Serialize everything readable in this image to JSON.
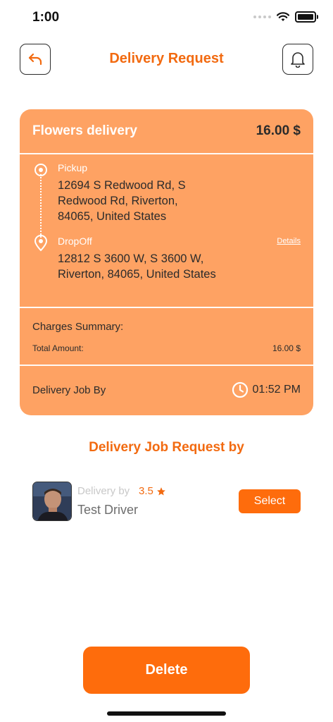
{
  "status_bar": {
    "time": "1:00"
  },
  "header": {
    "title": "Delivery Request",
    "back_icon": "back-arrow-icon",
    "bell_icon": "bell-icon"
  },
  "job": {
    "title": "Flowers delivery",
    "price": "16.00 $",
    "pickup": {
      "label": "Pickup",
      "address": "12694 S Redwood Rd, S Redwood Rd, Riverton, 84065, United States"
    },
    "dropoff": {
      "label": "DropOff",
      "address": "12812 S 3600 W, S 3600 W, Riverton, 84065, United States"
    },
    "details_link": "Details",
    "charges": {
      "title": "Charges Summary:",
      "total_label": "Total Amount:",
      "total_value": "16.00 $"
    },
    "job_by": {
      "label": "Delivery Job By",
      "time": "01:52 PM"
    }
  },
  "requests": {
    "title": "Delivery Job Request by",
    "items": [
      {
        "delivery_by_label": "Delivery by",
        "rating": "3.5",
        "name": "Test Driver",
        "select_label": "Select"
      }
    ]
  },
  "actions": {
    "delete_label": "Delete"
  },
  "colors": {
    "accent": "#f26a10",
    "button": "#fe6c0c",
    "card": "#fea263"
  }
}
